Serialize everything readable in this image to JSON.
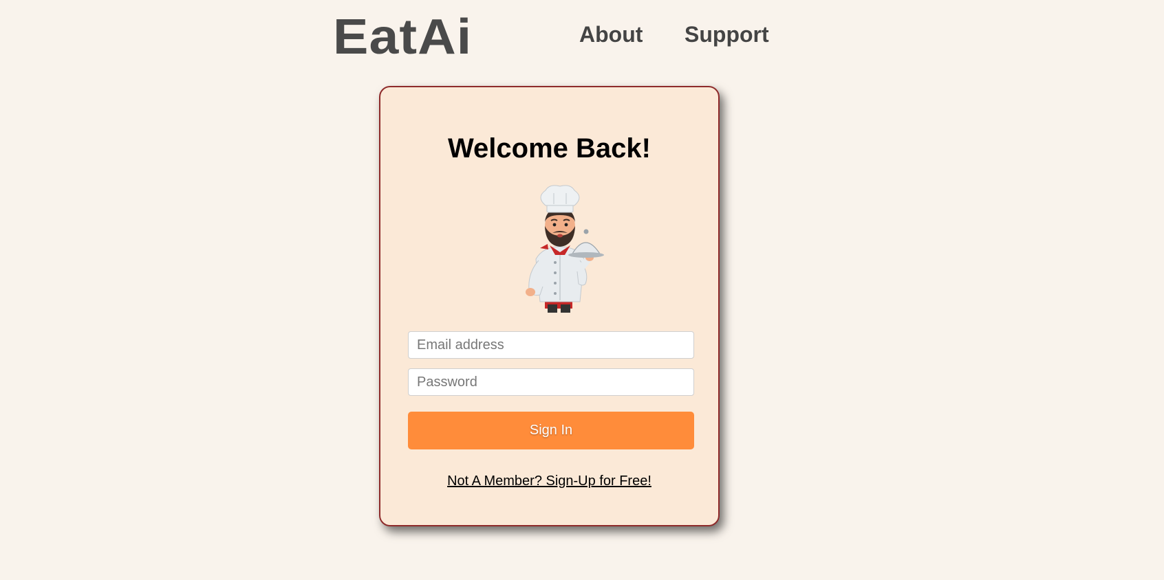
{
  "header": {
    "logo": "EatAi",
    "nav": {
      "about": "About",
      "support": "Support"
    }
  },
  "card": {
    "title": "Welcome Back!",
    "illustration_icon": "chef-holding-cloche-icon",
    "email": {
      "placeholder": "Email address",
      "value": ""
    },
    "password": {
      "placeholder": "Password",
      "value": ""
    },
    "signin_label": "Sign In",
    "signup_link": "Not A Member? Sign-Up for Free!"
  },
  "colors": {
    "page_background": "#f9f3ec",
    "card_background": "#fbe9d7",
    "card_border": "#8e2a2a",
    "button": "#ff8c3a",
    "logo": "#4a4a4a"
  }
}
